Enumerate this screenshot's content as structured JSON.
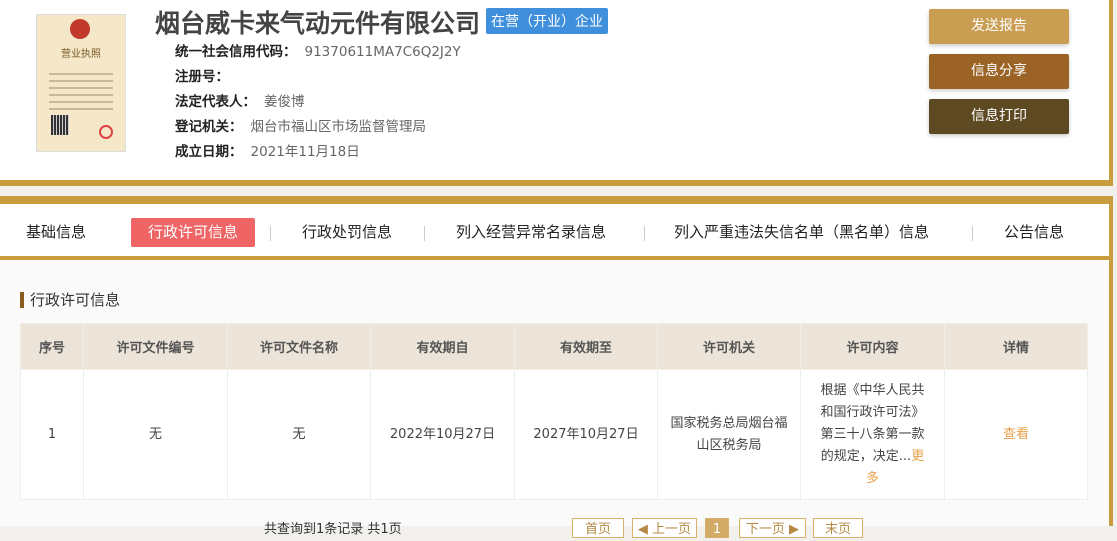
{
  "company": {
    "name": "烟台威卡来气动元件有限公司",
    "status": "在营（开业）企业",
    "license_text": "营业执照",
    "fields": [
      {
        "label": "统一社会信用代码：",
        "value": "91370611MA7C6Q2J2Y"
      },
      {
        "label": "注册号：",
        "value": ""
      },
      {
        "label": "法定代表人：",
        "value": "姜俊博"
      },
      {
        "label": "登记机关：",
        "value": "烟台市福山区市场监督管理局"
      },
      {
        "label": "成立日期：",
        "value": "2021年11月18日"
      }
    ]
  },
  "actions": {
    "send": "发送报告",
    "share": "信息分享",
    "print": "信息打印"
  },
  "tabs": [
    "基础信息",
    "行政许可信息",
    "行政处罚信息",
    "列入经营异常名录信息",
    "列入严重违法失信名单（黑名单）信息",
    "公告信息"
  ],
  "section_title": "行政许可信息",
  "table": {
    "headers": [
      "序号",
      "许可文件编号",
      "许可文件名称",
      "有效期自",
      "有效期至",
      "许可机关",
      "许可内容",
      "详情"
    ],
    "rows": [
      {
        "no": "1",
        "doc_no": "无",
        "doc_name": "无",
        "from": "2022年10月27日",
        "to": "2027年10月27日",
        "authority": "国家税务总局烟台福山区税务局",
        "content": "根据《中华人民共和国行政许可法》第三十八条第一款的规定，决定...",
        "more": "更多",
        "detail": "查看"
      }
    ]
  },
  "pagination": {
    "summary": "共查询到1条记录 共1页",
    "first": "首页",
    "prev": "◀ 上一页",
    "current": "1",
    "next": "下一页 ▶",
    "last": "末页"
  },
  "colors": {
    "gold": "#c99d3e",
    "active_tab": "#ef6464",
    "badge": "#3f8fdc"
  }
}
